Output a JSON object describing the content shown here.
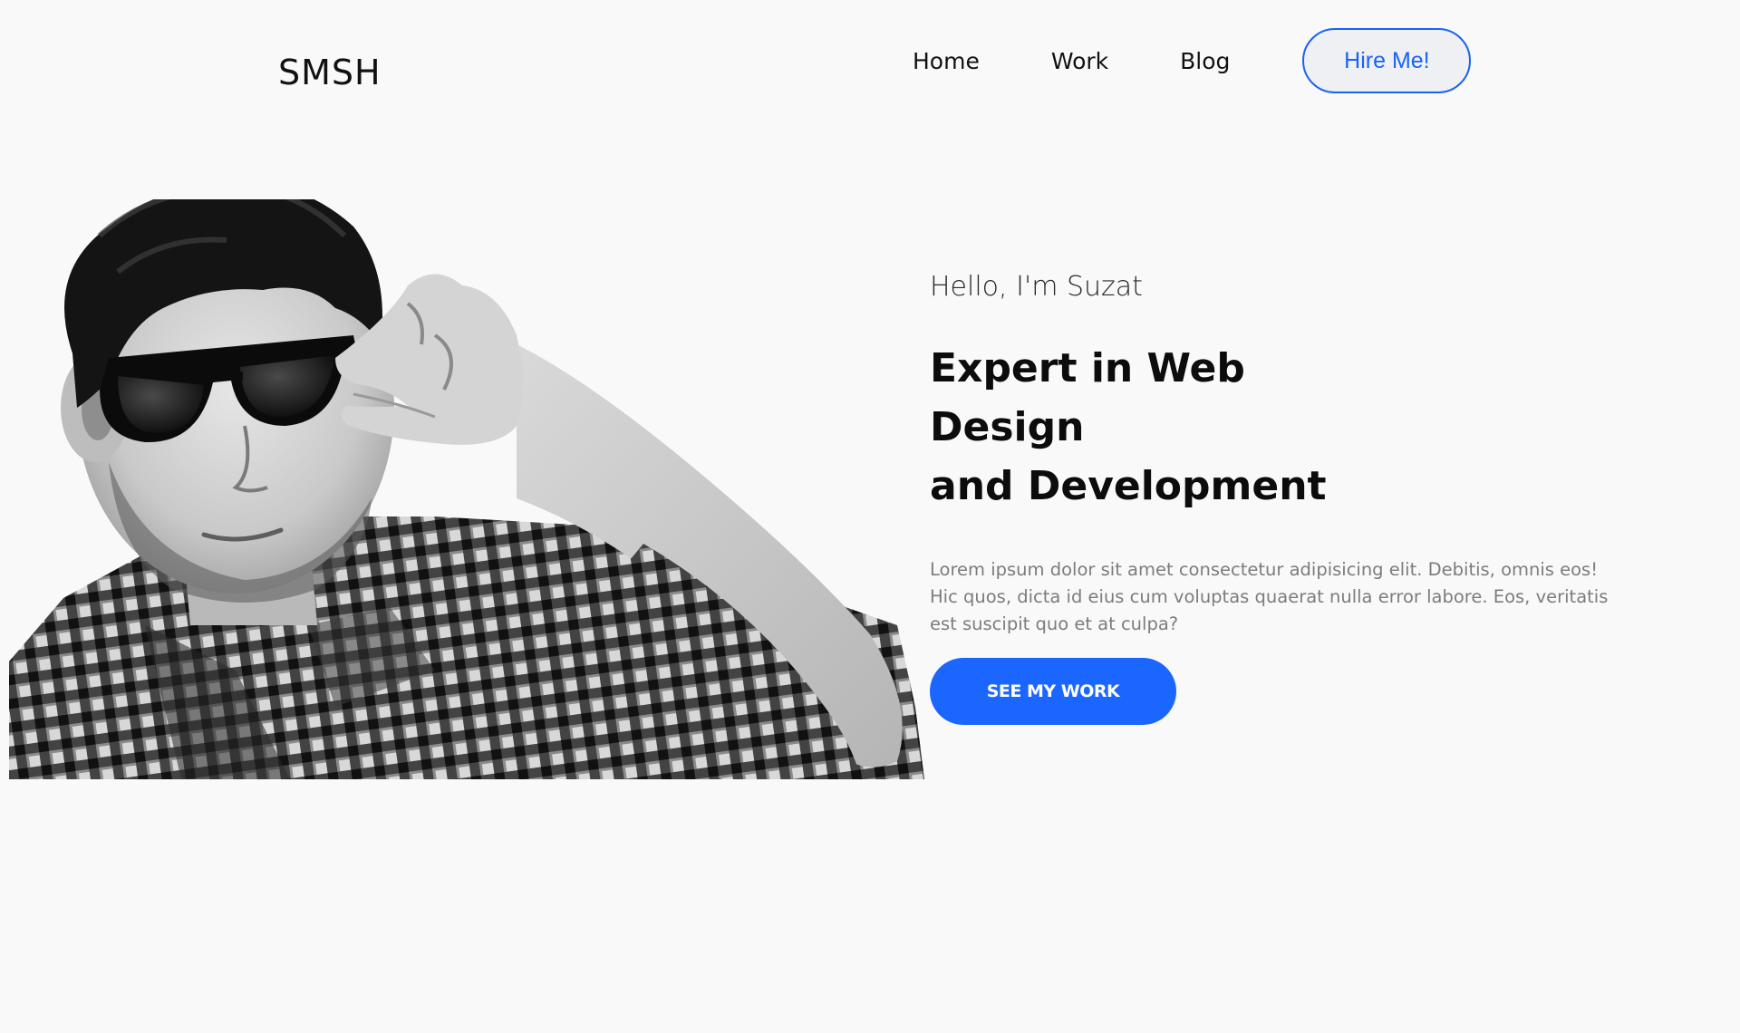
{
  "brand": {
    "logo": "SMSH"
  },
  "nav": {
    "items": [
      {
        "label": "Home"
      },
      {
        "label": "Work"
      },
      {
        "label": "Blog"
      }
    ],
    "hire_label": "Hire Me!"
  },
  "hero": {
    "greeting": "Hello, I'm Suzat",
    "headline_line1": "Expert in Web Design",
    "headline_line2": "and Development",
    "intro": "Lorem ipsum dolor sit amet consectetur adipisicing elit. Debitis, omnis eos! Hic quos, dicta id eius cum voluptas quaerat nulla error labore. Eos, veritatis est suscipit quo et at culpa?",
    "cta_label": "SEE MY WORK"
  },
  "colors": {
    "accent": "#1a66ff",
    "background": "#f9f9f9",
    "text": "#111111",
    "muted": "#7c7c7c"
  }
}
